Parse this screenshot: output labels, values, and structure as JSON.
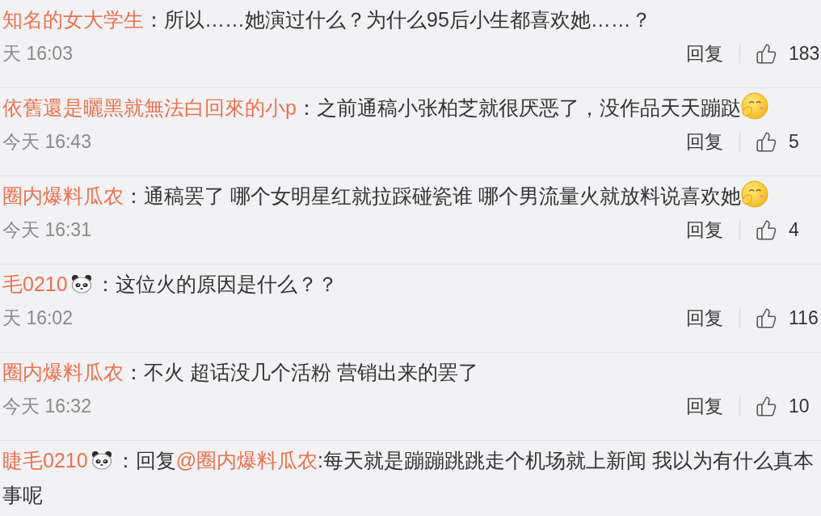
{
  "comments": [
    {
      "author": "知名的女大学生",
      "badge": false,
      "content": [
        {
          "kind": "text",
          "text": "：所以……她演过什么？为什么95后小生都喜欢她……？"
        }
      ],
      "time": "天 16:03",
      "reply_label": "回复",
      "likes": "183"
    },
    {
      "author": "依舊還是曬黑就無法白回來的小p",
      "badge": false,
      "content": [
        {
          "kind": "text",
          "text": "：之前通稿小张柏芝就很厌恶了，没作品天天蹦跶"
        },
        {
          "kind": "emoji"
        }
      ],
      "time": "今天 16:43",
      "reply_label": "回复",
      "likes": "5"
    },
    {
      "author": "圈内爆料瓜农",
      "badge": false,
      "content": [
        {
          "kind": "text",
          "text": "：通稿罢了 哪个女明星红就拉踩碰瓷谁 哪个男流量火就放料说喜欢她"
        },
        {
          "kind": "emoji"
        }
      ],
      "time": "今天 16:31",
      "reply_label": "回复",
      "likes": "4"
    },
    {
      "author": "毛0210",
      "badge": true,
      "content": [
        {
          "kind": "text",
          "text": "：这位火的原因是什么？？"
        }
      ],
      "time": "天 16:02",
      "reply_label": "回复",
      "likes": "116"
    },
    {
      "author": "圈内爆料瓜农",
      "badge": false,
      "content": [
        {
          "kind": "text",
          "text": "：不火 超话没几个活粉 营销出来的罢了"
        }
      ],
      "time": "今天 16:32",
      "reply_label": "回复",
      "likes": "10"
    },
    {
      "author": "睫毛0210",
      "badge": true,
      "content": [
        {
          "kind": "text",
          "text": "：回复"
        },
        {
          "kind": "mention",
          "text": "@圈内爆料瓜农"
        },
        {
          "kind": "text",
          "text": ":每天就是蹦蹦跳跳走个机场就上新闻 我以为有什么真本事呢"
        }
      ]
    }
  ]
}
